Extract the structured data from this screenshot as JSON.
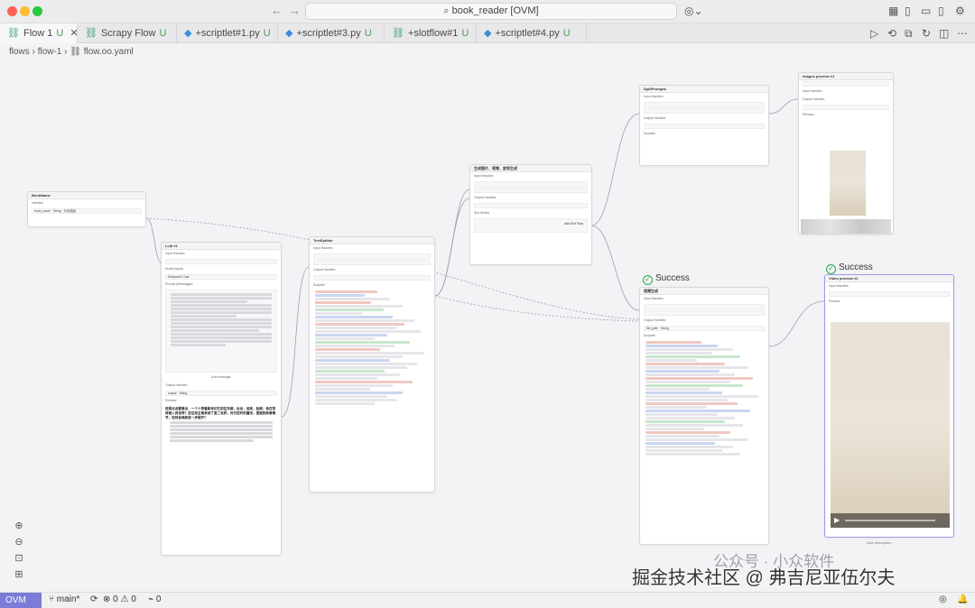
{
  "window": {
    "search_title": "book_reader [OVM]"
  },
  "tabs": [
    {
      "label": "Flow 1",
      "status": "U",
      "active": true
    },
    {
      "label": "Scrapy Flow",
      "status": "U"
    },
    {
      "label": "+scriptlet#1.py",
      "status": "U"
    },
    {
      "label": "+scriptlet#3.py",
      "status": "U"
    },
    {
      "label": "+slotflow#1",
      "status": "U"
    },
    {
      "label": "+scriptlet#4.py",
      "status": "U"
    }
  ],
  "breadcrumb": {
    "part1": "flows",
    "part2": "flow-1",
    "part3": "flow.oo.yaml"
  },
  "nodes": {
    "bookname": {
      "title": "BookName",
      "section": "Handles",
      "key": "book_name",
      "type": "String",
      "value": "乐系描绘"
    },
    "llm": {
      "title": "LLM #1",
      "input_handles": "Input Handles",
      "model": "Model Inputs",
      "model_value": "Deepseek Chat",
      "prompt": "Prompt (Messages)",
      "add_message": "Add message",
      "output_handles": "Output Handles",
      "output_key": "output",
      "output_type": "String",
      "preview": "Preview"
    },
    "textsplitter": {
      "title": "TextSplitter",
      "input_handles": "Input Handles",
      "output_handles": "Output Handles",
      "scriptlet": "Scriptlet"
    },
    "gen_image": {
      "title": "生成图片、视频、放背生成",
      "input_handles": "Input Handles",
      "output_handles": "Output Handles",
      "slot_nodes": "Slot Nodes",
      "add_slot": "Add Slot Flow"
    },
    "split_prompts": {
      "title": "SplitPrompts",
      "input_handles": "Input Handles",
      "output_handles": "Output Handles",
      "scriptlet": "Scriptlet"
    },
    "images_preview": {
      "title": "Images preview #1",
      "input_handles": "Input Handles",
      "output_handles": "Output Handles",
      "preview": "Preview"
    },
    "video_gen": {
      "title": "视频生成",
      "input_handles": "Input Handles",
      "output_handles": "Output Handles",
      "output_key": "file_path",
      "output_type": "String",
      "scriptlet": "Scriptlet"
    },
    "video_preview": {
      "title": "Video preview #1",
      "input_handles": "Input Handles",
      "preview": "Preview",
      "caption": "Add description"
    }
  },
  "success": {
    "label1": "Success",
    "label2": "Success"
  },
  "preview_text": {
    "headline": "但是北龙要拿出，一个人带着新世记忆前往东部，出龙，经来，赵颜，他在等待被入间世界？这位男主角来到了第二世界，对付这时的魔法，里面的故事情节，如何会继续进一步展开？"
  },
  "statusbar": {
    "ovm": "OVM",
    "branch": "main*",
    "errors": "0",
    "warnings": "0",
    "ports": "0"
  },
  "watermark": {
    "line1": "公众号 · 小众软件",
    "line2": "掘金技术社区 @ 弗吉尼亚伍尔夫"
  },
  "colors": {
    "accent": "#7b7bd8",
    "success": "#2aa84a",
    "edge": "#9aa0b0"
  }
}
